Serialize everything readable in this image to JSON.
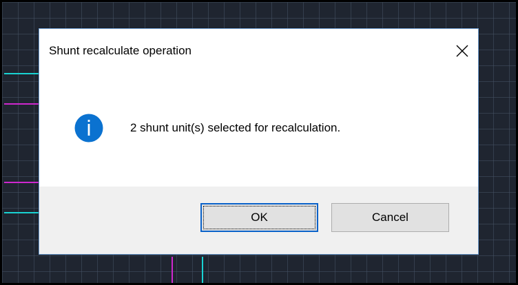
{
  "dialog": {
    "title": "Shunt recalculate operation",
    "message": "2 shunt unit(s) selected for recalculation.",
    "icon": "info-icon",
    "close_icon": "close-icon",
    "buttons": {
      "ok_label": "OK",
      "cancel_label": "Cancel"
    }
  },
  "colors": {
    "canvas_background": "#1f2530",
    "wire_cyan": "#19d3d3",
    "wire_magenta": "#cf28cf",
    "info_icon_blue": "#0b72d0",
    "focus_border": "#0a62c9",
    "button_area": "#f0f0f0"
  }
}
